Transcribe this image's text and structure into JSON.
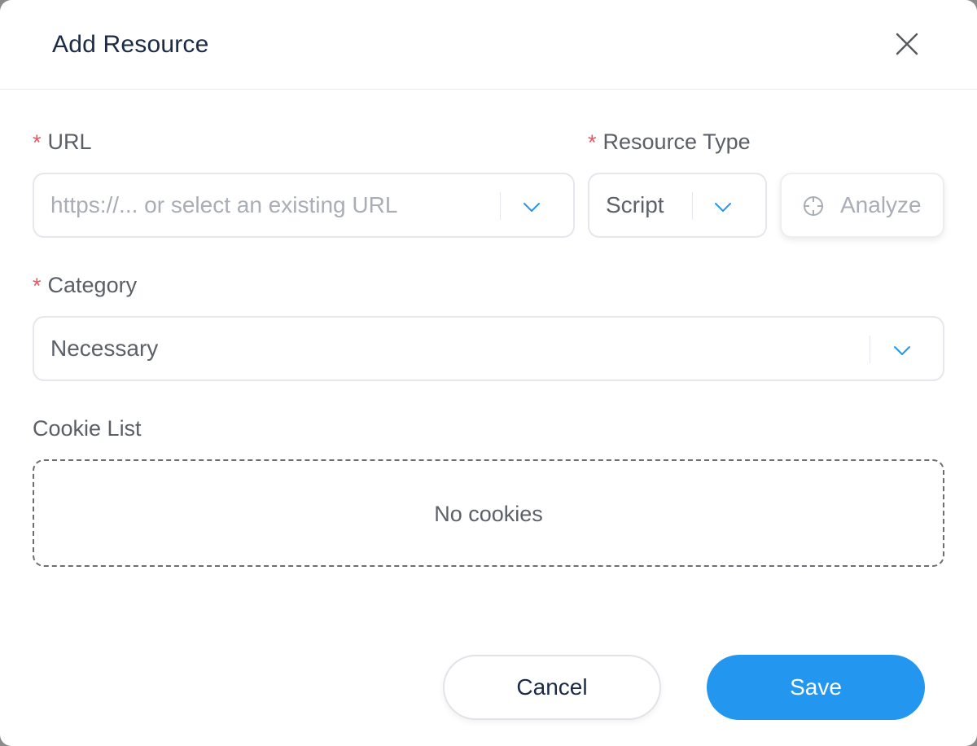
{
  "dialog": {
    "title": "Add Resource",
    "close_icon": "close-icon"
  },
  "url": {
    "label": "URL",
    "required_mark": "*",
    "placeholder": "https://... or select an existing URL",
    "value": ""
  },
  "resource_type": {
    "label": "Resource Type",
    "required_mark": "*",
    "value": "Script"
  },
  "analyze": {
    "label": "Analyze",
    "icon": "crosshair-icon"
  },
  "category": {
    "label": "Category",
    "required_mark": "*",
    "value": "Necessary"
  },
  "cookies": {
    "label": "Cookie List",
    "empty_text": "No cookies"
  },
  "footer": {
    "cancel_label": "Cancel",
    "save_label": "Save"
  },
  "colors": {
    "accent": "#2396f0",
    "required": "#f0535e",
    "title": "#1c2b45"
  }
}
